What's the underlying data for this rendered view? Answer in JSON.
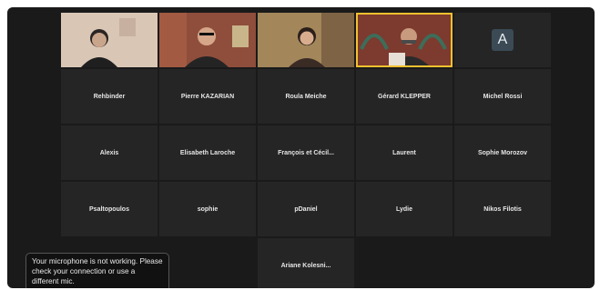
{
  "participants": [
    {
      "name": "",
      "kind": "video"
    },
    {
      "name": "",
      "kind": "video"
    },
    {
      "name": "",
      "kind": "video"
    },
    {
      "name": "",
      "kind": "video"
    },
    {
      "name": "A",
      "kind": "avatar"
    },
    {
      "name": "Rehbinder"
    },
    {
      "name": "Pierre KAZARIAN"
    },
    {
      "name": "Roula Meiche"
    },
    {
      "name": "Gérard KLEPPER"
    },
    {
      "name": "Michel Rossi"
    },
    {
      "name": "Alexis"
    },
    {
      "name": "Elisabeth Laroche"
    },
    {
      "name": "François et Cécil..."
    },
    {
      "name": "Laurent"
    },
    {
      "name": "Sophie Morozov"
    },
    {
      "name": "Psaltopoulos"
    },
    {
      "name": "sophie"
    },
    {
      "name": "pDaniel"
    },
    {
      "name": "Lydie"
    },
    {
      "name": "Nikos Filotis"
    },
    {
      "name": "Ariane Kolesni..."
    }
  ],
  "mic_warning": "Your microphone is not working. Please check your connection or use a different mic.",
  "colors": {
    "active_speaker": "#f3c12f",
    "tile_bg": "#252525",
    "frame_bg": "#1a1a1a"
  }
}
